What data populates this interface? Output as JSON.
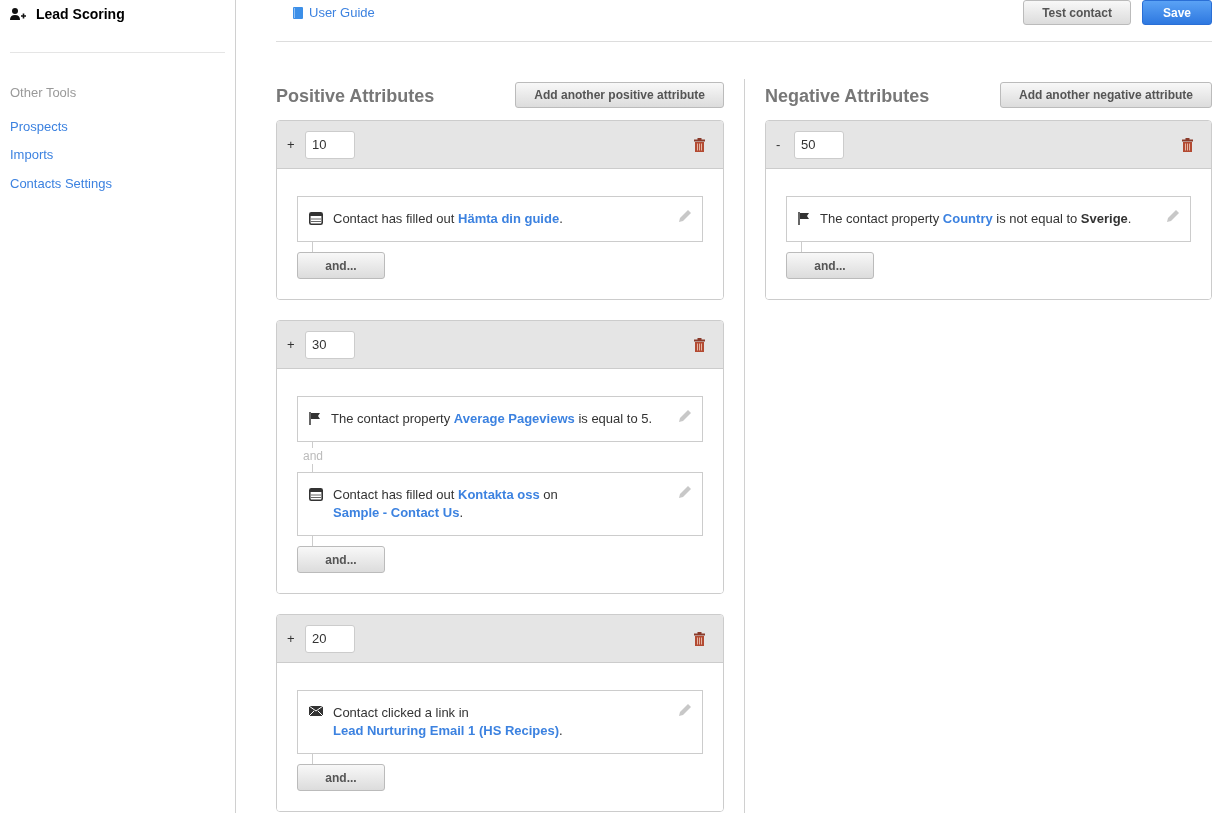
{
  "sidebar": {
    "title": "Lead Scoring",
    "section_label": "Other Tools",
    "links": [
      "Prospects",
      "Imports",
      "Contacts Settings"
    ]
  },
  "header": {
    "guide_link": "User Guide",
    "buttons": [
      {
        "label": "Test contact",
        "kind": "default"
      },
      {
        "label": "Save",
        "kind": "primary"
      }
    ]
  },
  "columns": [
    {
      "title": "Positive Attributes",
      "add_button": "Add another positive attribute",
      "groups": [
        {
          "sign": "+",
          "points": "10",
          "conditions": [
            {
              "kind": "form",
              "parts": [
                {
                  "kind": "text",
                  "text": "Contact has filled out "
                },
                {
                  "kind": "link",
                  "text": "Hämta din guide"
                },
                {
                  "kind": "text",
                  "text": "."
                }
              ]
            }
          ],
          "and_button": "and..."
        },
        {
          "sign": "+",
          "points": "30",
          "conditions": [
            {
              "kind": "property",
              "parts": [
                {
                  "kind": "text",
                  "text": "The contact property "
                },
                {
                  "kind": "link",
                  "text": "Average Pageviews"
                },
                {
                  "kind": "text",
                  "text": " is equal to "
                },
                {
                  "kind": "value",
                  "text": "5"
                },
                {
                  "kind": "text",
                  "text": "."
                }
              ]
            },
            {
              "kind": "form",
              "parts": [
                {
                  "kind": "text",
                  "text": "Contact has filled out "
                },
                {
                  "kind": "link",
                  "text": "Kontakta oss"
                },
                {
                  "kind": "text",
                  "text": " on "
                },
                {
                  "kind": "link",
                  "text": "Sample - Contact Us"
                },
                {
                  "kind": "text",
                  "text": "."
                }
              ]
            }
          ],
          "joiner": "and",
          "and_button": "and..."
        },
        {
          "sign": "+",
          "points": "20",
          "conditions": [
            {
              "kind": "email",
              "parts": [
                {
                  "kind": "text",
                  "text": "Contact clicked a link in "
                },
                {
                  "kind": "link",
                  "text": "Lead Nurturing Email 1 (HS Recipes)"
                },
                {
                  "kind": "text",
                  "text": "."
                }
              ]
            }
          ],
          "and_button": "and..."
        }
      ]
    },
    {
      "title": "Negative Attributes",
      "add_button": "Add another negative attribute",
      "groups": [
        {
          "sign": "-",
          "points": "50",
          "conditions": [
            {
              "kind": "property",
              "parts": [
                {
                  "kind": "text",
                  "text": "The contact property "
                },
                {
                  "kind": "link",
                  "text": "Country"
                },
                {
                  "kind": "text",
                  "text": " is not equal to "
                },
                {
                  "kind": "bold",
                  "text": "Sverige"
                },
                {
                  "kind": "text",
                  "text": "."
                }
              ]
            }
          ],
          "and_button": "and..."
        }
      ]
    }
  ]
}
